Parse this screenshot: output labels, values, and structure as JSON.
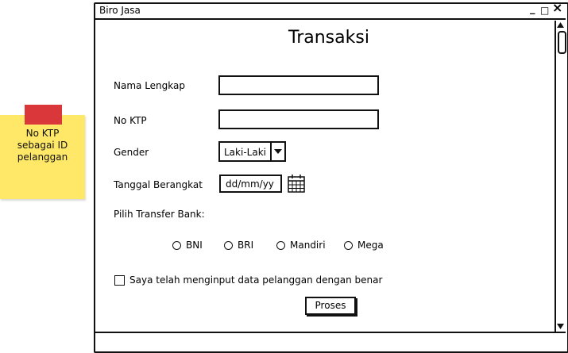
{
  "note": {
    "lines": [
      "No KTP",
      "sebagai ID",
      "pelanggan"
    ]
  },
  "window": {
    "title": "Biro Jasa",
    "controls": {
      "minimize": "_",
      "maximize": "□",
      "close": "×"
    }
  },
  "form": {
    "heading": "Transaksi",
    "nama_label": "Nama Lengkap",
    "nama_value": "",
    "ktp_label": "No KTP",
    "ktp_value": "",
    "gender_label": "Gender",
    "gender_selected": "Laki-Laki",
    "tanggal_label": "Tanggal Berangkat",
    "tanggal_placeholder": "dd/mm/yy",
    "bank_label": "Pilih Transfer Bank:",
    "banks": [
      "BNI",
      "BRI",
      "Mandiri",
      "Mega"
    ],
    "confirm_label": "Saya telah menginput data pelanggan dengan benar",
    "submit_label": "Proses"
  },
  "colors": {
    "sticky": "#ffe868",
    "tape": "#d9373a"
  }
}
